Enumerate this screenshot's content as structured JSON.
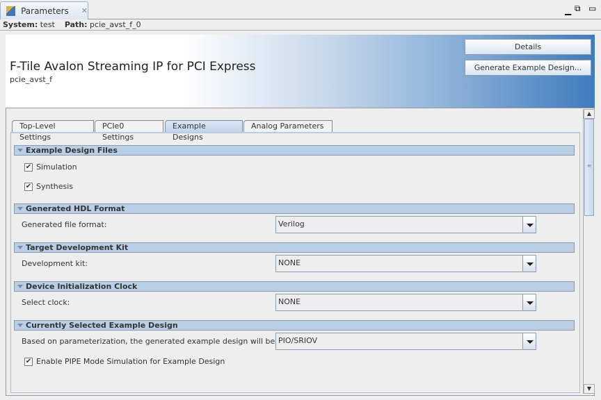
{
  "window": {
    "tab_title": "Parameters",
    "close_icon": "close-icon"
  },
  "info": {
    "system_label": "System:",
    "system_value": "test",
    "path_label": "Path:",
    "path_value": "pcie_avst_f_0"
  },
  "header": {
    "title": "F-Tile Avalon Streaming IP for PCI Express",
    "subtitle": "pcie_avst_f",
    "details_button": "Details",
    "generate_button": "Generate Example Design..."
  },
  "tabs": [
    "Top-Level Settings",
    "PCIe0 Settings",
    "Example Designs",
    "Analog  Parameters"
  ],
  "active_tab": "Example Designs",
  "sections": {
    "files": {
      "title": "Example Design Files",
      "simulation": "Simulation",
      "simulation_checked": true,
      "synthesis": "Synthesis",
      "synthesis_checked": true
    },
    "hdl": {
      "title": "Generated HDL Format",
      "label": "Generated file format:",
      "value": "Verilog"
    },
    "kit": {
      "title": "Target Development Kit",
      "label": "Development kit:",
      "value": "NONE"
    },
    "clock": {
      "title": "Device Initialization Clock",
      "label": "Select clock:",
      "value": "NONE"
    },
    "current": {
      "title": "Currently Selected Example Design",
      "label": "Based on parameterization, the generated example design will be:",
      "value": "PIO/SRIOV",
      "pipe_label": "Enable PIPE Mode Simulation for Example Design",
      "pipe_checked": true
    }
  },
  "check_mark": "✔"
}
